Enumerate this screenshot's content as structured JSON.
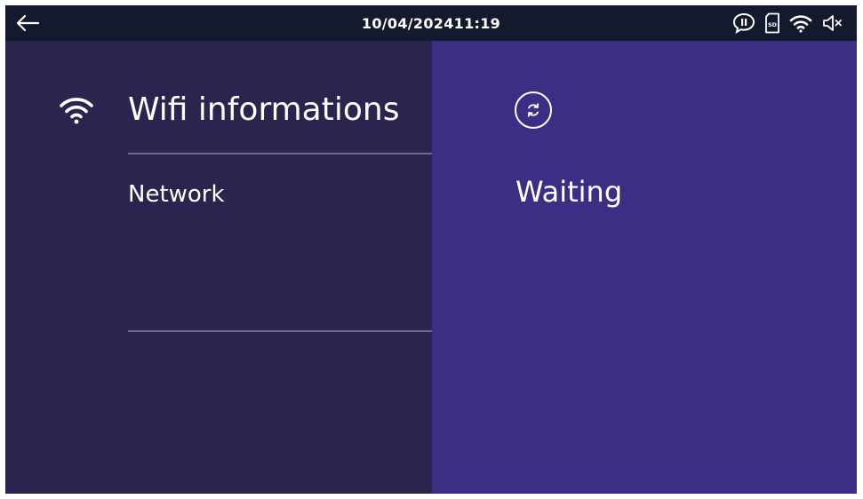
{
  "status_bar": {
    "datetime": "10/04/202411:19",
    "icons": [
      "back-arrow-icon",
      "talk-icon",
      "sd-card-icon",
      "wifi-icon",
      "speaker-muted-icon"
    ]
  },
  "left_panel": {
    "title": "Wifi informations",
    "network_label": "Network",
    "icon": "wifi-icon"
  },
  "right_panel": {
    "status_text": "Waiting",
    "icon": "refresh-icon"
  },
  "colors": {
    "status_bar_bg": "#141a2e",
    "left_panel_bg": "#2a244f",
    "right_panel_bg": "#3c2d85",
    "text": "#ffffff",
    "divider": "#6d6890"
  }
}
